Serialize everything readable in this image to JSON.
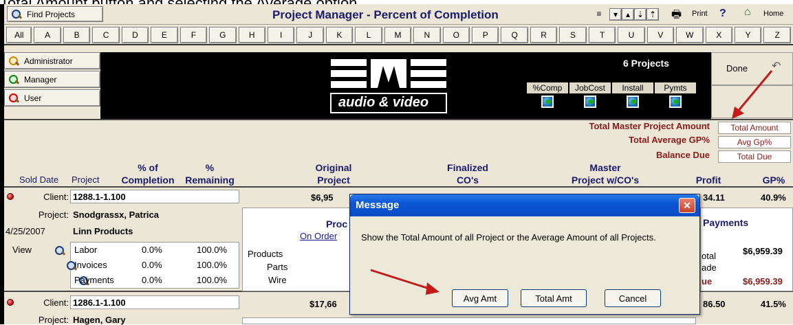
{
  "caption": "Total Amount button and selecting the Average option.",
  "topbar": {
    "find_label": "Find Projects",
    "title": "Project Manager - Percent of Completion",
    "print_label": "Print",
    "help_label": "?",
    "home_label": "Home"
  },
  "letters": [
    "All",
    "A",
    "B",
    "C",
    "D",
    "E",
    "F",
    "G",
    "H",
    "I",
    "J",
    "K",
    "L",
    "M",
    "N",
    "O",
    "P",
    "Q",
    "R",
    "S",
    "T",
    "U",
    "V",
    "W",
    "X",
    "Y",
    "Z"
  ],
  "roles": [
    "Administrator",
    "Manager",
    "User"
  ],
  "banner": {
    "logo_text": "audio & video",
    "project_count": "6 Projects",
    "buttons": [
      "%Comp",
      "JobCost",
      "Install",
      "Pymts"
    ]
  },
  "done_label": "Done",
  "totals": {
    "labels": [
      "Total Master Project Amount",
      "Total Average GP%",
      "Balance Due"
    ],
    "buttons": [
      "Total Amount",
      "Avg Gp%",
      "Total Due"
    ]
  },
  "columns": {
    "sold_date": "Sold Date",
    "project": "Project",
    "pct_completion_1": "% of",
    "pct_completion_2": "Completion",
    "pct_remaining_1": "%",
    "pct_remaining_2": "Remaining",
    "original_1": "Original",
    "original_2": "Project",
    "finalized_1": "Finalized",
    "finalized_2": "CO's",
    "master_1": "Master",
    "master_2": "Project w/CO's",
    "profit": "Profit",
    "gp": "GP%"
  },
  "row1": {
    "client_label": "Client:",
    "client_value": "1288.1-1.100",
    "project_label": "Project:",
    "project_value": "Snodgrassx, Patrica",
    "date": "4/25/2007",
    "company": "Linn Products",
    "view_label": "View",
    "lines": [
      {
        "name": "Labor",
        "pct": "0.0%",
        "rem": "100.0%"
      },
      {
        "name": "Invoices",
        "pct": "0.0%",
        "rem": "100.0%"
      },
      {
        "name": "Payments",
        "pct": "0.0%",
        "rem": "100.0%"
      }
    ],
    "original": "$6,95",
    "profit": "34.11",
    "gp": "40.9%",
    "prod_head": "Proc",
    "on_order": "On Order",
    "prod_rows": [
      "Products",
      "Parts",
      "Wire"
    ],
    "payments_head": "Payments",
    "pay_rows": [
      "otal",
      "ade",
      "ue"
    ],
    "pay_total": "$6,959.39",
    "pay_due": "$6,959.39"
  },
  "row2": {
    "client_label": "Client:",
    "client_value": "1286.1-1.100",
    "project_label": "Project:",
    "project_value": "Hagen, Gary",
    "original": "$17,66",
    "profit": "86.50",
    "gp": "41.5%"
  },
  "dialog": {
    "title": "Message",
    "close": "✕",
    "message": "Show the Total Amount of all Project or the Average Amount of all Projects.",
    "buttons": [
      "Avg Amt",
      "Total Amt",
      "Cancel"
    ]
  }
}
